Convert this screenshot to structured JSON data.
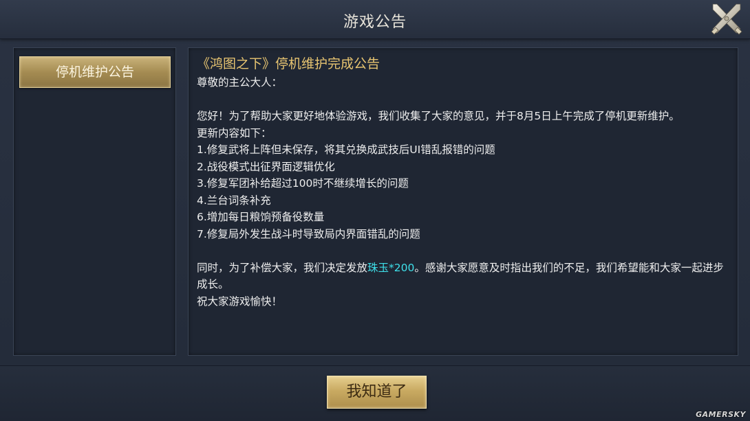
{
  "dialog": {
    "title": "游戏公告",
    "close_icon": "crossed-swords-close-icon"
  },
  "sidebar": {
    "items": [
      {
        "label": "停机维护公告",
        "selected": true
      }
    ]
  },
  "notice": {
    "title": "《鸿图之下》停机维护完成公告",
    "greeting": "尊敬的主公大人：",
    "intro": "您好！为了帮助大家更好地体验游戏，我们收集了大家的意见，并于8月5日上午完成了停机更新维护。",
    "list_header": "更新内容如下：",
    "updates": [
      "1.修复武将上阵但未保存，将其兑换成武技后UI错乱报错的问题",
      "2.战役模式出征界面逻辑优化",
      "3.修复军团补给超过100时不继续增长的问题",
      "4.兰台词条补充",
      "6.增加每日粮饷预备役数量",
      "7.修复局外发生战斗时导致局内界面错乱的问题"
    ],
    "compensation_prefix": "同时，为了补偿大家，我们决定发放",
    "compensation_item": "珠玉*200",
    "compensation_suffix": "。感谢大家愿意及时指出我们的不足，我们希望能和大家一起进步成长。",
    "closing": "祝大家游戏愉快！"
  },
  "footer": {
    "ok_label": "我知道了"
  },
  "watermark": "GAMERSKY",
  "colors": {
    "title_gold": "#e8c571",
    "highlight_cyan": "#3ee0ea",
    "button_gold": "#c9aa62"
  }
}
